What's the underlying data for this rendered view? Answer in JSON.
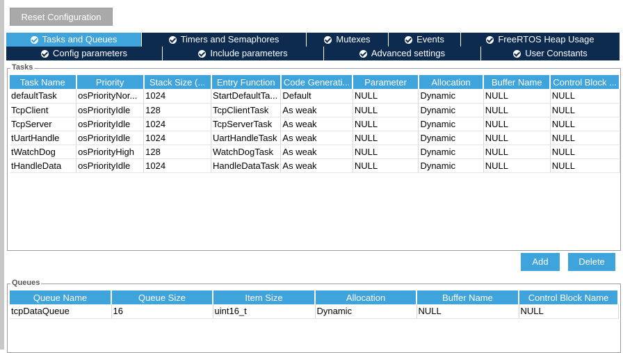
{
  "toolbar": {
    "reset_label": "Reset Configuration"
  },
  "tabs_row1": [
    {
      "label": "Tasks and Queues",
      "active": true
    },
    {
      "label": "Timers and Semaphores",
      "active": false
    },
    {
      "label": "Mutexes",
      "active": false
    },
    {
      "label": "Events",
      "active": false
    },
    {
      "label": "FreeRTOS Heap Usage",
      "active": false
    }
  ],
  "tabs_row2": [
    {
      "label": "Config parameters"
    },
    {
      "label": "Include parameters"
    },
    {
      "label": "Advanced settings"
    },
    {
      "label": "User Constants"
    }
  ],
  "tasks": {
    "group_label": "Tasks",
    "columns": [
      "Task Name",
      "Priority",
      "Stack Size (...",
      "Entry Function",
      "Code Generati...",
      "Parameter",
      "Allocation",
      "Buffer Name",
      "Control Block ..."
    ],
    "rows": [
      [
        "defaultTask",
        "osPriorityNor...",
        "1024",
        "StartDefaultTa...",
        "Default",
        "NULL",
        "Dynamic",
        "NULL",
        "NULL"
      ],
      [
        "TcpClient",
        "osPriorityIdle",
        "128",
        "TcpClientTask",
        "As weak",
        "NULL",
        "Dynamic",
        "NULL",
        "NULL"
      ],
      [
        "TcpServer",
        "osPriorityIdle",
        "1024",
        "TcpServerTask",
        "As weak",
        "NULL",
        "Dynamic",
        "NULL",
        "NULL"
      ],
      [
        "tUartHandle",
        "osPriorityIdle",
        "1024",
        "UartHandleTask",
        "As weak",
        "NULL",
        "Dynamic",
        "NULL",
        "NULL"
      ],
      [
        "tWatchDog",
        "osPriorityHigh",
        "128",
        "WatchDogTask",
        "As weak",
        "NULL",
        "Dynamic",
        "NULL",
        "NULL"
      ],
      [
        "tHandleData",
        "osPriorityIdle",
        "1024",
        "HandleDataTask",
        "As weak",
        "NULL",
        "Dynamic",
        "NULL",
        "NULL"
      ]
    ],
    "add_label": "Add",
    "delete_label": "Delete"
  },
  "queues": {
    "group_label": "Queues",
    "columns": [
      "Queue Name",
      "Queue Size",
      "Item Size",
      "Allocation",
      "Buffer Name",
      "Control Block Name"
    ],
    "rows": [
      [
        "tcpDataQueue",
        "16",
        "uint16_t",
        "Dynamic",
        "NULL",
        "NULL"
      ]
    ]
  },
  "colors": {
    "tab_dark": "#0d2a4f",
    "accent_blue": "#3fa3dc",
    "reset_gray": "#a9a9a9"
  }
}
